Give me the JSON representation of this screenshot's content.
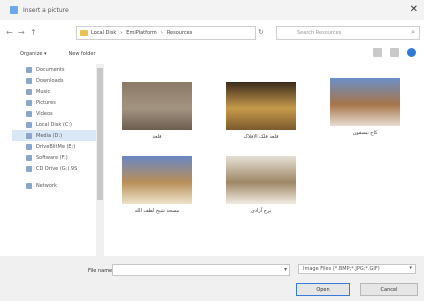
{
  "window": {
    "title": "Insert a picture",
    "close_glyph": "✕"
  },
  "nav": {
    "back": "←",
    "forward": "→",
    "up": "↑"
  },
  "address": {
    "path": [
      "Local Disk",
      "EmiPlatform",
      "Resources"
    ],
    "separator": "›",
    "refresh": "↻",
    "search_placeholder": "Search Resources",
    "search_glyph": "⌕"
  },
  "toolbar": {
    "organize": "Organize ▾",
    "new_folder": "New folder"
  },
  "sidebar": {
    "items": [
      {
        "label": "Documents",
        "icon": "documents-icon"
      },
      {
        "label": "Downloads",
        "icon": "downloads-icon"
      },
      {
        "label": "Music",
        "icon": "music-icon"
      },
      {
        "label": "Pictures",
        "icon": "pictures-icon"
      },
      {
        "label": "Videos",
        "icon": "videos-icon"
      },
      {
        "label": "Local Disk (C:)",
        "icon": "drive-icon"
      },
      {
        "label": "Media (D:)",
        "icon": "drive-icon"
      },
      {
        "label": "DriveBlitMe (E:)",
        "icon": "drive-icon"
      },
      {
        "label": "Software (F:)",
        "icon": "drive-icon"
      },
      {
        "label": "CD Drive (G:) 9S",
        "icon": "cd-drive-icon"
      },
      {
        "label": "Network",
        "icon": "network-icon"
      }
    ],
    "selected_index": 6
  },
  "files": [
    {
      "caption": "قلعة",
      "colors": [
        "#8a7a66",
        "#a39481",
        "#6c5e4f"
      ]
    },
    {
      "caption": "قلعه فلک الافلاک",
      "colors": [
        "#3b2b1c",
        "#c69a4b",
        "#7a5a2c"
      ]
    },
    {
      "caption": "کاخ تیسفون",
      "colors": [
        "#6a8fc7",
        "#a7754a",
        "#e8ddd2"
      ]
    },
    {
      "caption": "مسجد شیخ لطف الله",
      "colors": [
        "#6a86c3",
        "#b98f58",
        "#eee4cc"
      ]
    },
    {
      "caption": "برج آزادی",
      "colors": [
        "#e7e0d6",
        "#9e8766",
        "#f2ebe2"
      ]
    }
  ],
  "footer": {
    "file_name_label": "File name:",
    "file_name_value": "",
    "file_type": "Image Files (*.BMP;*.JPG;*.GIF)",
    "open": "Open",
    "cancel": "Cancel"
  }
}
